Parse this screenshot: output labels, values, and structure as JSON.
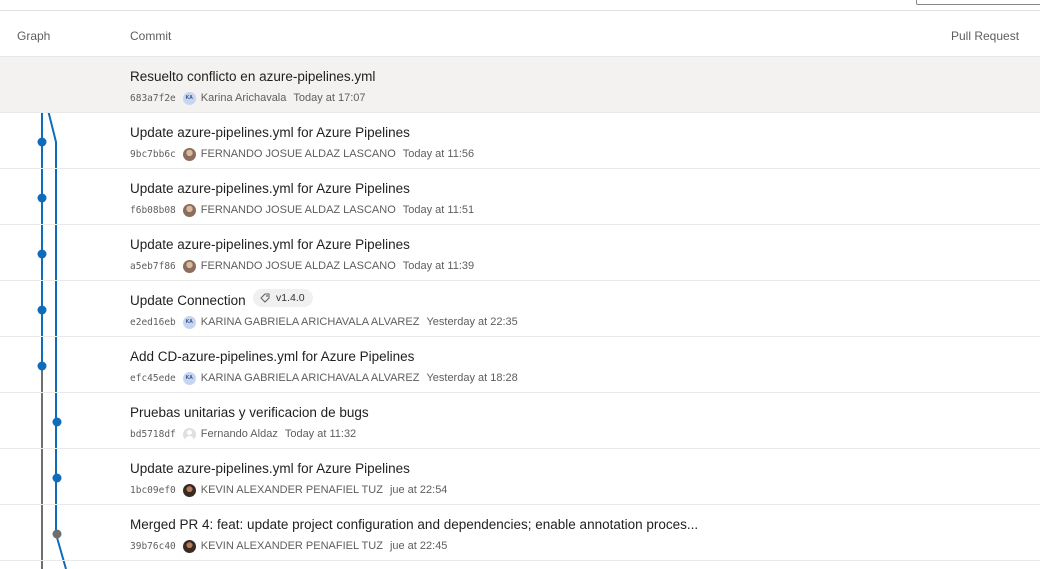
{
  "columns": {
    "graph": "Graph",
    "commit": "Commit",
    "pull_request": "Pull Request"
  },
  "commits": [
    {
      "title": "Resuelto conflicto en azure-pipelines.yml",
      "hash": "683a7f2e",
      "author": "Karina Arichavala",
      "avatar": "KA",
      "date": "Today at 17:07"
    },
    {
      "title": "Update azure-pipelines.yml for Azure Pipelines",
      "hash": "9bc7bb6c",
      "author": "FERNANDO JOSUE ALDAZ LASCANO",
      "avatar": "",
      "date": "Today at 11:56"
    },
    {
      "title": "Update azure-pipelines.yml for Azure Pipelines",
      "hash": "f6b08b08",
      "author": "FERNANDO JOSUE ALDAZ LASCANO",
      "avatar": "",
      "date": "Today at 11:51"
    },
    {
      "title": "Update azure-pipelines.yml for Azure Pipelines",
      "hash": "a5eb7f86",
      "author": "FERNANDO JOSUE ALDAZ LASCANO",
      "avatar": "",
      "date": "Today at 11:39"
    },
    {
      "title": "Update Connection",
      "hash": "e2ed16eb",
      "author": "KARINA GABRIELA ARICHAVALA ALVAREZ",
      "avatar": "KA",
      "date": "Yesterday at 22:35",
      "tag": "v1.4.0"
    },
    {
      "title": "Add CD-azure-pipelines.yml for Azure Pipelines",
      "hash": "efc45ede",
      "author": "KARINA GABRIELA ARICHAVALA ALVAREZ",
      "avatar": "KA",
      "date": "Yesterday at 18:28"
    },
    {
      "title": "Pruebas unitarias y verificacion de bugs",
      "hash": "bd5718df",
      "author": "Fernando Aldaz",
      "avatar": "",
      "date": "Today at 11:32"
    },
    {
      "title": "Update azure-pipelines.yml for Azure Pipelines",
      "hash": "1bc09ef0",
      "author": "KEVIN ALEXANDER PENAFIEL TUZ",
      "avatar": "",
      "date": "jue at 22:54"
    },
    {
      "title": "Merged PR 4: feat: update project configuration and dependencies; enable annotation proces...",
      "hash": "39b76c40",
      "author": "KEVIN ALEXANDER PENAFIEL TUZ",
      "avatar": "",
      "date": "jue at 22:45"
    }
  ],
  "graph_colors": {
    "main": "#6e6e6e",
    "branch": "#0f6cbd",
    "merge_node": "#6e6e6e"
  },
  "icons": {
    "tag": "tag-icon"
  }
}
